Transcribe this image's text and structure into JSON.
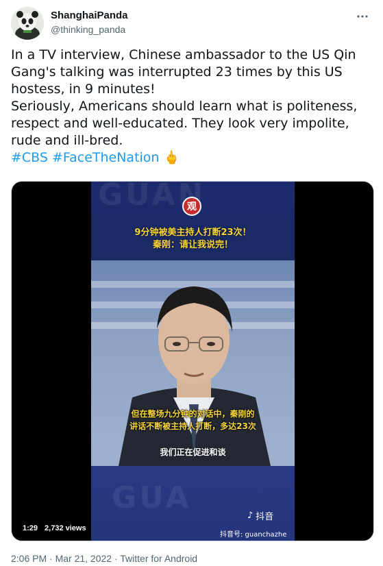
{
  "user": {
    "display_name": "ShanghaiPanda",
    "handle": "@thinking_panda"
  },
  "tweet": {
    "paragraph1": "In a TV interview, Chinese ambassador to the US Qin Gang's talking was interrupted 23 times by this US hostess, in 9 minutes!",
    "paragraph2": "Seriously, Americans should learn what is politeness, respect and well-educated. They look very impolite, rude and ill-bred.",
    "hashtag1": "#CBS",
    "hashtag2": "#FaceTheNation",
    "emoji": "🖕"
  },
  "media": {
    "logo_char": "观",
    "headline_line1": "9分钟被美主持人打断23次！",
    "headline_line2": "秦刚：请让我说完！",
    "subtitle_line1": "但在整场九分钟的对话中，秦刚的",
    "subtitle_line2": "讲话不断被主持人打断，多达23次",
    "subtitle_line3": "我们正在促进和谈",
    "tiktok_label": "抖音",
    "tiktok_id": "抖音号: guanchazhe",
    "duration": "1:29",
    "views": "2,732 views"
  },
  "footer": {
    "timestamp": "2:06 PM · Mar 21, 2022 · Twitter for Android"
  }
}
